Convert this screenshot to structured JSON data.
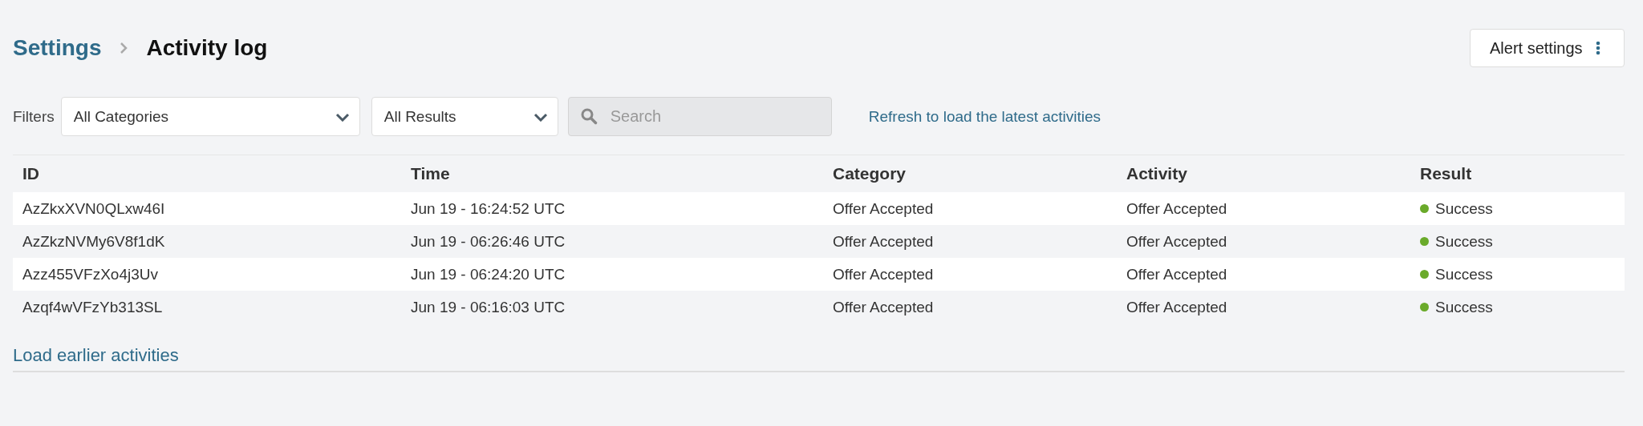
{
  "breadcrumb": {
    "parent": "Settings",
    "current": "Activity log"
  },
  "alert_button": {
    "label": "Alert settings"
  },
  "filters": {
    "label": "Filters",
    "category": "All Categories",
    "result": "All Results",
    "search_placeholder": "Search",
    "refresh_link": "Refresh to load the latest activities"
  },
  "table": {
    "columns": [
      "ID",
      "Time",
      "Category",
      "Activity",
      "Result"
    ],
    "rows": [
      {
        "id": "AzZkxXVN0QLxw46I",
        "time": "Jun 19 - 16:24:52 UTC",
        "category": "Offer Accepted",
        "activity": "Offer Accepted",
        "result": "Success",
        "color": "#6aaa2a"
      },
      {
        "id": "AzZkzNVMy6V8f1dK",
        "time": "Jun 19 - 06:26:46 UTC",
        "category": "Offer Accepted",
        "activity": "Offer Accepted",
        "result": "Success",
        "color": "#6aaa2a"
      },
      {
        "id": "Azz455VFzXo4j3Uv",
        "time": "Jun 19 - 06:24:20 UTC",
        "category": "Offer Accepted",
        "activity": "Offer Accepted",
        "result": "Success",
        "color": "#6aaa2a"
      },
      {
        "id": "Azqf4wVFzYb313SL",
        "time": "Jun 19 - 06:16:03 UTC",
        "category": "Offer Accepted",
        "activity": "Offer Accepted",
        "result": "Success",
        "color": "#6aaa2a"
      }
    ]
  },
  "load_more": "Load earlier activities"
}
